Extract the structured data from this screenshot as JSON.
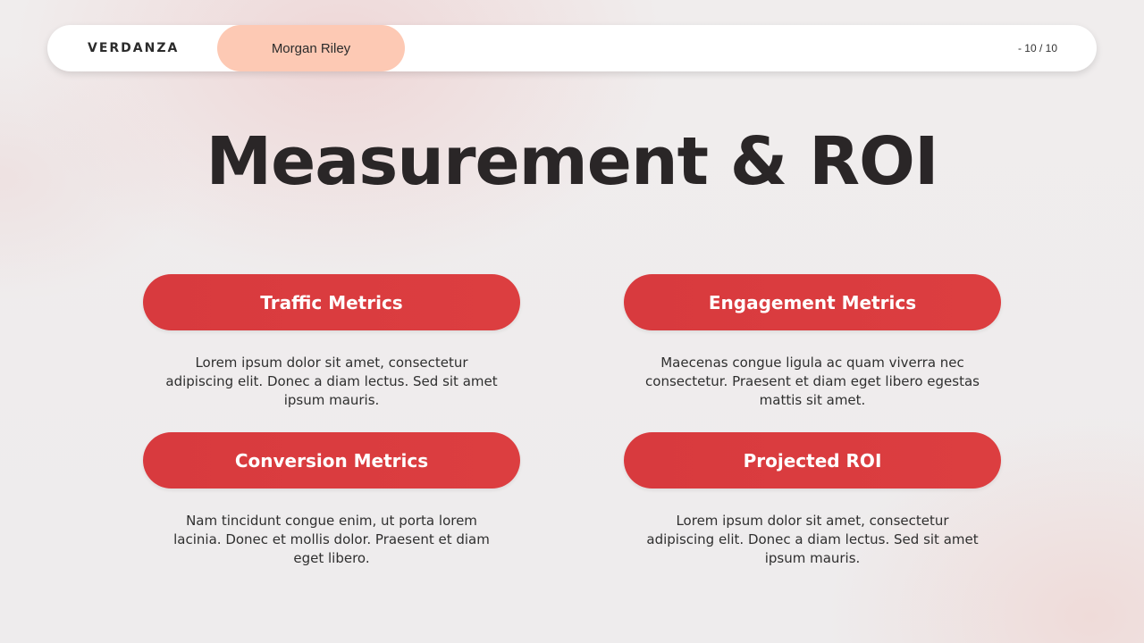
{
  "header": {
    "brand": "VERDANZA",
    "presenter": "Morgan Riley",
    "page_indicator": "- 10 / 10"
  },
  "slide": {
    "title": "Measurement & ROI"
  },
  "sections": [
    {
      "heading": "Traffic Metrics",
      "text": "Lorem ipsum dolor sit amet, consectetur adipiscing elit. Donec a diam lectus. Sed sit amet ipsum mauris."
    },
    {
      "heading": "Engagement Metrics",
      "text": "Maecenas congue ligula ac quam viverra nec consectetur. Praesent et diam eget libero egestas mattis sit amet."
    },
    {
      "heading": "Conversion Metrics",
      "text": "Nam tincidunt congue enim, ut porta lorem lacinia. Donec et mollis dolor. Praesent et diam eget libero."
    },
    {
      "heading": "Projected ROI",
      "text": "Lorem ipsum dolor sit amet, consectetur adipiscing elit. Donec a diam lectus. Sed sit amet ipsum mauris."
    }
  ],
  "colors": {
    "accent_red": "#d83a3e",
    "presenter_pill": "#fdc9b4",
    "title_text": "#2a2627"
  }
}
